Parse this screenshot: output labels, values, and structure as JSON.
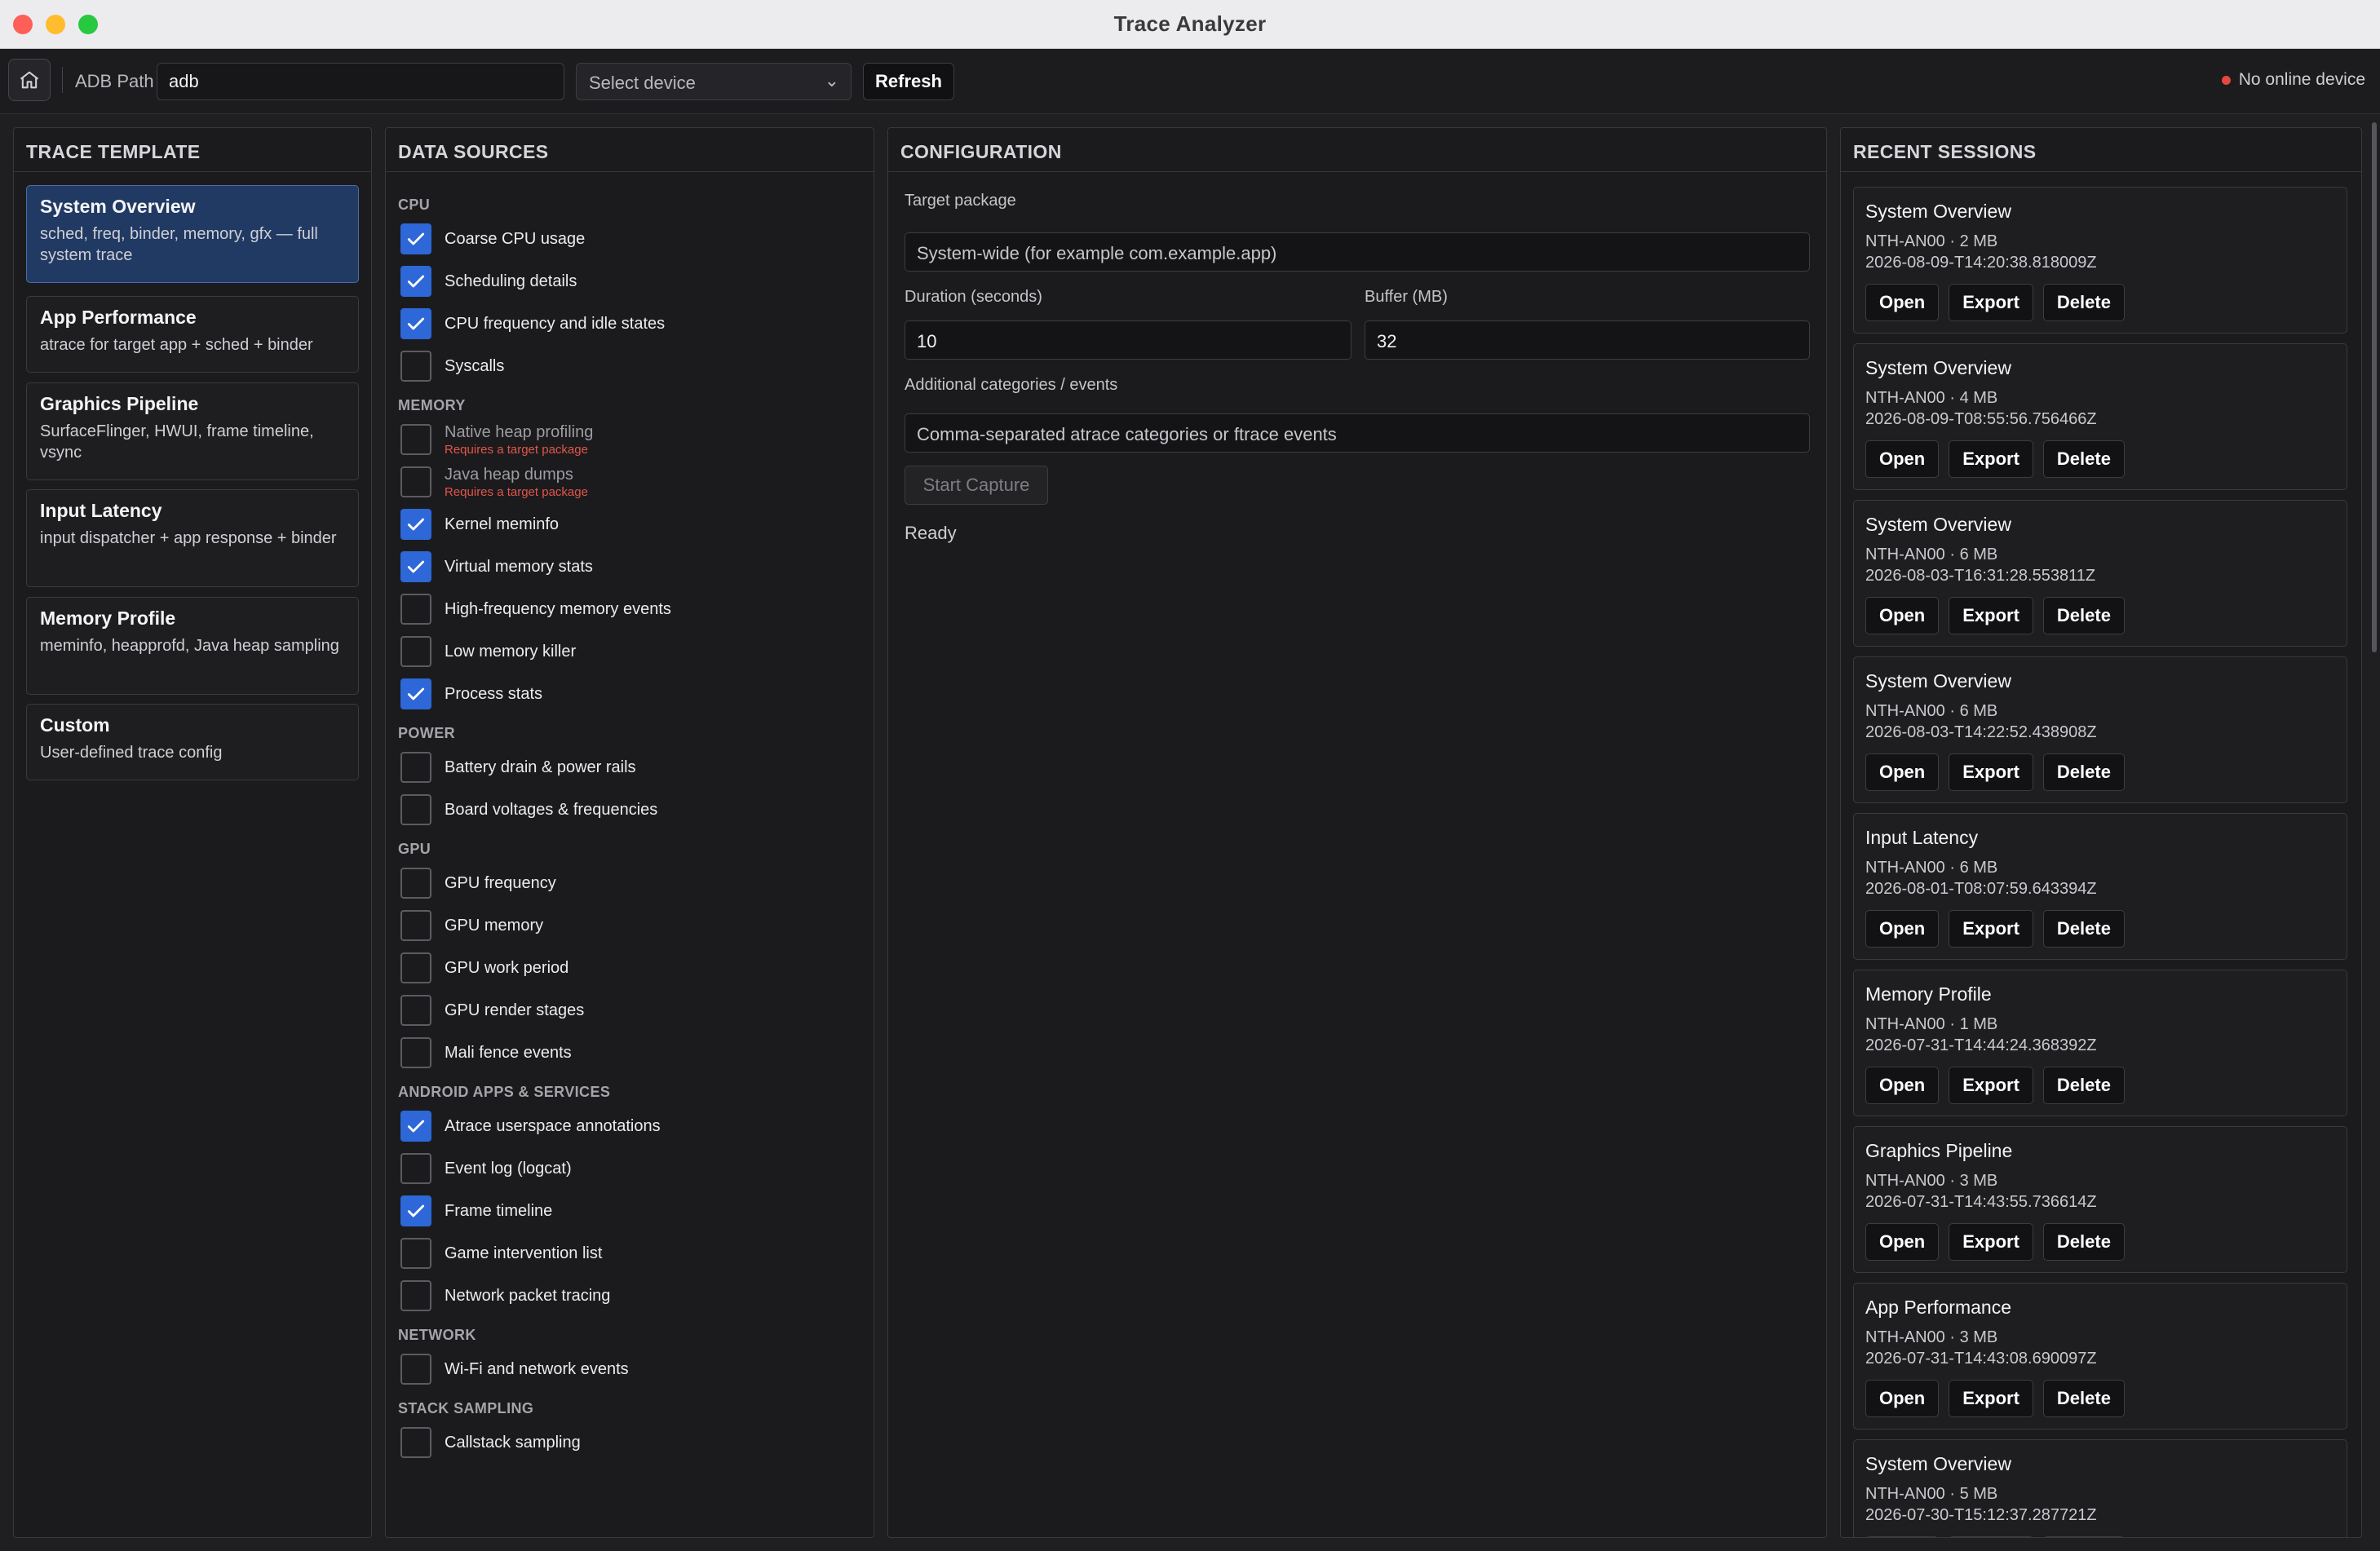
{
  "window": {
    "title": "Trace Analyzer"
  },
  "toolbar": {
    "adb_label": "ADB Path",
    "adb_value": "adb",
    "device_placeholder": "Select device",
    "refresh_label": "Refresh",
    "status_text": "No online device",
    "status_color": "#e5483f"
  },
  "templates": {
    "heading": "TRACE TEMPLATE",
    "items": [
      {
        "name": "System Overview",
        "desc": "sched, freq, binder, memory, gfx — full system trace",
        "selected": true
      },
      {
        "name": "App Performance",
        "desc": "atrace for target app + sched + binder",
        "selected": false
      },
      {
        "name": "Graphics Pipeline",
        "desc": "SurfaceFlinger, HWUI, frame timeline, vsync",
        "selected": false
      },
      {
        "name": "Input Latency",
        "desc": "input dispatcher + app response + binder",
        "selected": false
      },
      {
        "name": "Memory Profile",
        "desc": "meminfo, heapprofd, Java heap sampling",
        "selected": false
      },
      {
        "name": "Custom",
        "desc": "User-defined trace config",
        "selected": false
      }
    ]
  },
  "sources": {
    "heading": "DATA SOURCES",
    "groups": [
      {
        "name": "CPU",
        "items": [
          {
            "label": "Coarse CPU usage",
            "checked": true
          },
          {
            "label": "Scheduling details",
            "checked": true
          },
          {
            "label": "CPU frequency and idle states",
            "checked": true
          },
          {
            "label": "Syscalls",
            "checked": false
          }
        ]
      },
      {
        "name": "MEMORY",
        "items": [
          {
            "label": "Native heap profiling",
            "checked": false,
            "note": "Requires a target package",
            "disabled": true
          },
          {
            "label": "Java heap dumps",
            "checked": false,
            "note": "Requires a target package",
            "disabled": true
          },
          {
            "label": "Kernel meminfo",
            "checked": true
          },
          {
            "label": "Virtual memory stats",
            "checked": true
          },
          {
            "label": "High-frequency memory events",
            "checked": false
          },
          {
            "label": "Low memory killer",
            "checked": false
          },
          {
            "label": "Process stats",
            "checked": true
          }
        ]
      },
      {
        "name": "POWER",
        "items": [
          {
            "label": "Battery drain & power rails",
            "checked": false
          },
          {
            "label": "Board voltages & frequencies",
            "checked": false
          }
        ]
      },
      {
        "name": "GPU",
        "items": [
          {
            "label": "GPU frequency",
            "checked": false
          },
          {
            "label": "GPU memory",
            "checked": false
          },
          {
            "label": "GPU work period",
            "checked": false
          },
          {
            "label": "GPU render stages",
            "checked": false
          },
          {
            "label": "Mali fence events",
            "checked": false
          }
        ]
      },
      {
        "name": "ANDROID APPS & SERVICES",
        "items": [
          {
            "label": "Atrace userspace annotations",
            "checked": true
          },
          {
            "label": "Event log (logcat)",
            "checked": false
          },
          {
            "label": "Frame timeline",
            "checked": true
          },
          {
            "label": "Game intervention list",
            "checked": false
          },
          {
            "label": "Network packet tracing",
            "checked": false
          }
        ]
      },
      {
        "name": "NETWORK",
        "items": [
          {
            "label": "Wi-Fi and network events",
            "checked": false
          }
        ]
      },
      {
        "name": "STACK SAMPLING",
        "items": [
          {
            "label": "Callstack sampling",
            "checked": false
          }
        ]
      }
    ]
  },
  "config": {
    "heading": "CONFIGURATION",
    "target_label": "Target package",
    "target_placeholder": "System-wide (for example com.example.app)",
    "duration_label": "Duration (seconds)",
    "duration_value": "10",
    "buffer_label": "Buffer (MB)",
    "buffer_value": "32",
    "extra_label": "Additional categories / events",
    "extra_placeholder": "Comma-separated atrace categories or ftrace events",
    "start_label": "Start Capture",
    "status": "Ready"
  },
  "sessions": {
    "heading": "RECENT SESSIONS",
    "open_label": "Open",
    "export_label": "Export",
    "delete_label": "Delete",
    "items": [
      {
        "name": "System Overview",
        "meta": "NTH-AN00 · 2 MB",
        "time": "2026-08-09-T14:20:38.818009Z"
      },
      {
        "name": "System Overview",
        "meta": "NTH-AN00 · 4 MB",
        "time": "2026-08-09-T08:55:56.756466Z"
      },
      {
        "name": "System Overview",
        "meta": "NTH-AN00 · 6 MB",
        "time": "2026-08-03-T16:31:28.553811Z"
      },
      {
        "name": "System Overview",
        "meta": "NTH-AN00 · 6 MB",
        "time": "2026-08-03-T14:22:52.438908Z"
      },
      {
        "name": "Input Latency",
        "meta": "NTH-AN00 · 6 MB",
        "time": "2026-08-01-T08:07:59.643394Z"
      },
      {
        "name": "Memory Profile",
        "meta": "NTH-AN00 · 1 MB",
        "time": "2026-07-31-T14:44:24.368392Z"
      },
      {
        "name": "Graphics Pipeline",
        "meta": "NTH-AN00 · 3 MB",
        "time": "2026-07-31-T14:43:55.736614Z"
      },
      {
        "name": "App Performance",
        "meta": "NTH-AN00 · 3 MB",
        "time": "2026-07-31-T14:43:08.690097Z"
      },
      {
        "name": "System Overview",
        "meta": "NTH-AN00 · 5 MB",
        "time": "2026-07-30-T15:12:37.287721Z"
      }
    ]
  }
}
